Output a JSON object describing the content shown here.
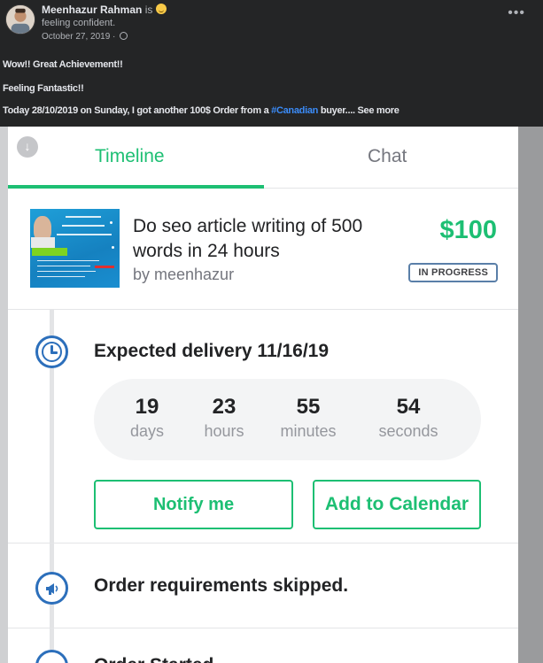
{
  "post": {
    "author": "Meenhazur Rahman",
    "is_text": "is",
    "feeling": "feeling confident.",
    "date": "October 27, 2019 ·",
    "more_icon": "more-horizontal-icon",
    "lines": {
      "line1": "Wow!! Great Achievement!!",
      "line2": "Feeling Fantastic!!",
      "line3_before": "Today 28/10/2019 on Sunday, I got another 100$ Order from a ",
      "line3_hashtag": "#Canadian",
      "line3_after": " buyer....",
      "see_more": " See more"
    }
  },
  "order": {
    "tabs": {
      "timeline": "Timeline",
      "chat": "Chat"
    },
    "gig_title": "Do seo article writing of 500 words in 24 hours",
    "seller": "by meenhazur",
    "price": "$100",
    "status": "IN PROGRESS",
    "delivery_title": "Expected delivery 11/16/19",
    "countdown": [
      {
        "value": "19",
        "unit": "days"
      },
      {
        "value": "23",
        "unit": "hours"
      },
      {
        "value": "55",
        "unit": "minutes"
      },
      {
        "value": "54",
        "unit": "seconds"
      }
    ],
    "notify_label": "Notify me",
    "calendar_label": "Add to Calendar",
    "requirements_text": "Order requirements skipped.",
    "next_item_text": "Order Started"
  },
  "colors": {
    "accent_green": "#1dbf73",
    "timeline_blue": "#2c6fbb",
    "facebook_bg": "#242526",
    "hashtag_blue": "#3b8bf7"
  }
}
